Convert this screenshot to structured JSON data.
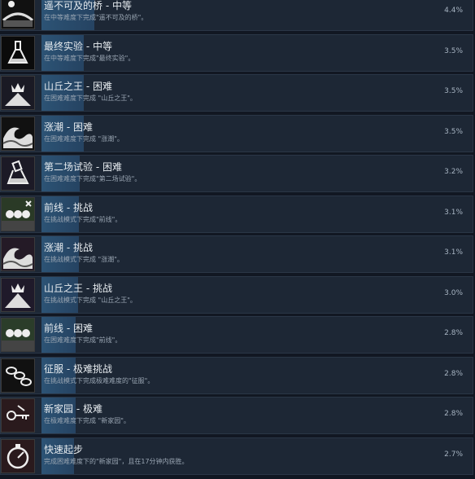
{
  "achievements": [
    {
      "title": "遥不可及的桥 - 中等",
      "desc": "在中等难度下完成\"遥不可及的桥\"。",
      "pct": "4.4%",
      "fill": 0.044,
      "icon": "bridge-icon"
    },
    {
      "title": "最终实验 - 中等",
      "desc": "在中等难度下完成\"最终实验\"。",
      "pct": "3.5%",
      "fill": 0.035,
      "icon": "flask-icon"
    },
    {
      "title": "山丘之王 - 困难",
      "desc": "在困难难度下完成 \"山丘之王\"。",
      "pct": "3.5%",
      "fill": 0.035,
      "icon": "crown-mountain-icon"
    },
    {
      "title": "涨潮 - 困难",
      "desc": "在困难难度下完成 \"涨潮\"。",
      "pct": "3.5%",
      "fill": 0.035,
      "icon": "wave-icon"
    },
    {
      "title": "第二场试验 - 困难",
      "desc": "在困难难度下完成\"第二场试验\"。",
      "pct": "3.2%",
      "fill": 0.032,
      "icon": "flask-icon"
    },
    {
      "title": "前线 - 挑战",
      "desc": "在挑战模式下完成\"前线\"。",
      "pct": "3.1%",
      "fill": 0.031,
      "icon": "skulls-icon"
    },
    {
      "title": "涨潮 - 挑战",
      "desc": "在挑战模式下完成 \"涨潮\"。",
      "pct": "3.1%",
      "fill": 0.031,
      "icon": "wave-icon"
    },
    {
      "title": "山丘之王 - 挑战",
      "desc": "在挑战模式下完成 \"山丘之王\"。",
      "pct": "3.0%",
      "fill": 0.03,
      "icon": "crown-mountain-icon"
    },
    {
      "title": "前线 - 困难",
      "desc": "在困难难度下完成\"前线\"。",
      "pct": "2.8%",
      "fill": 0.028,
      "icon": "skulls-icon"
    },
    {
      "title": "征服 - 极难挑战",
      "desc": "在挑战模式下完成极难难度的\"征服\"。",
      "pct": "2.8%",
      "fill": 0.028,
      "icon": "chains-icon"
    },
    {
      "title": "新家园 - 极难",
      "desc": "在极难难度下完成 \"新家园\"。",
      "pct": "2.8%",
      "fill": 0.028,
      "icon": "keys-icon"
    },
    {
      "title": "快速起步",
      "desc": "完成困难难度下的\"新家园\"，且在17分钟内获胜。",
      "pct": "2.7%",
      "fill": 0.027,
      "icon": "stopwatch-icon"
    }
  ],
  "colors": {
    "row_bg": "#1d2735",
    "fill": "#2f5b80",
    "page_bg": "#111722"
  }
}
